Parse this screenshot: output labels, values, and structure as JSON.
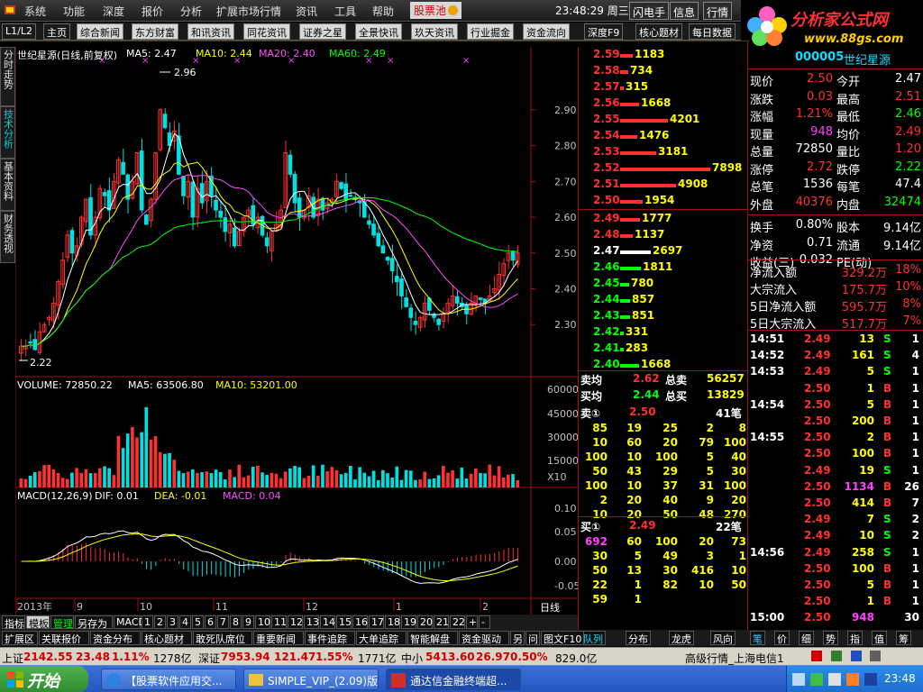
{
  "menu": {
    "items": [
      "系统",
      "功能",
      "深度",
      "报价",
      "分析",
      "扩展市场行情",
      "资讯",
      "工具",
      "帮助"
    ],
    "stock_pool": "股票池",
    "clock": "23:48:29 周三",
    "buttons": [
      "闪电手",
      "信息",
      "行情"
    ]
  },
  "logo": {
    "text": "分析家公式网",
    "url": "www.88gs.com"
  },
  "toolbar": {
    "level": "L1/L2",
    "home": "主页",
    "items": [
      "综合新闻",
      "东方财富",
      "和讯资讯",
      "同花资讯",
      "证券之星",
      "全景快讯",
      "玖天资讯",
      "行业掘金",
      "资金流向"
    ],
    "right": [
      "深度F9",
      "核心题材",
      "每日数据"
    ]
  },
  "left_tabs": [
    "分时走势",
    "技术分析",
    "基本资料",
    "财务透视"
  ],
  "chart": {
    "title": "世纪星源(日线,前复权)",
    "ma": [
      {
        "label": "MA5: 2.47",
        "color": "#ffffff"
      },
      {
        "label": "MA10: 2.44",
        "color": "#ffff00"
      },
      {
        "label": "MA20: 2.40",
        "color": "#ff4dff"
      },
      {
        "label": "MA60: 2.49",
        "color": "#00ff00"
      }
    ],
    "high_label": "2.96",
    "low_label": "2.22",
    "price_ticks": [
      "2.90",
      "2.80",
      "2.70",
      "2.60",
      "2.50",
      "2.40",
      "2.30"
    ],
    "volume_title": "VOLUME: 72850.22",
    "vol_ma5": "MA5: 63506.80",
    "vol_ma10": "MA10: 53201.00",
    "vol_ticks": [
      "60000",
      "45000",
      "30000",
      "15000",
      "X10"
    ],
    "macd_title": "MACD(12,26,9)",
    "macd_dif": "DIF: 0.01",
    "macd_dea": "DEA: -0.01",
    "macd_val": "MACD: 0.04",
    "macd_ticks": [
      "0.10",
      "0.05",
      "0.00",
      "-0.05"
    ],
    "date_axis": [
      "2013年",
      "9",
      "10",
      "11",
      "12",
      "1",
      "2"
    ],
    "period": "日线"
  },
  "sell_book": [
    {
      "price": "2.59",
      "vol": "1183",
      "fill": 0.14
    },
    {
      "price": "2.58",
      "vol": "734",
      "fill": 0.09
    },
    {
      "price": "2.57",
      "vol": "315",
      "fill": 0.04
    },
    {
      "price": "2.56",
      "vol": "1668",
      "fill": 0.21
    },
    {
      "price": "2.55",
      "vol": "4201",
      "fill": 0.53
    },
    {
      "price": "2.54",
      "vol": "1476",
      "fill": 0.19
    },
    {
      "price": "2.53",
      "vol": "3181",
      "fill": 0.4
    },
    {
      "price": "2.52",
      "vol": "7898",
      "fill": 1.0
    },
    {
      "price": "2.51",
      "vol": "4908",
      "fill": 0.62
    },
    {
      "price": "2.50",
      "vol": "1954",
      "fill": 0.25
    }
  ],
  "buy_book": [
    {
      "price": "2.49",
      "vol": "1777",
      "fill": 0.22,
      "pc": "#ff3030"
    },
    {
      "price": "2.48",
      "vol": "1137",
      "fill": 0.14,
      "pc": "#ff3030"
    },
    {
      "price": "2.47",
      "vol": "2697",
      "fill": 0.34,
      "pc": "#ffffff"
    },
    {
      "price": "2.46",
      "vol": "1811",
      "fill": 0.23,
      "pc": "#00ff00"
    },
    {
      "price": "2.45",
      "vol": "780",
      "fill": 0.1,
      "pc": "#00ff00"
    },
    {
      "price": "2.44",
      "vol": "857",
      "fill": 0.11,
      "pc": "#00ff00"
    },
    {
      "price": "2.43",
      "vol": "851",
      "fill": 0.11,
      "pc": "#00ff00"
    },
    {
      "price": "2.42",
      "vol": "331",
      "fill": 0.04,
      "pc": "#00ff00"
    },
    {
      "price": "2.41",
      "vol": "283",
      "fill": 0.04,
      "pc": "#00ff00"
    },
    {
      "price": "2.40",
      "vol": "1668",
      "fill": 0.21,
      "pc": "#00ff00"
    }
  ],
  "avg": {
    "sell_avg_label": "卖均",
    "sell_avg": "2.62",
    "sell_total_label": "总卖",
    "sell_total": "56257",
    "buy_avg_label": "买均",
    "buy_avg": "2.44",
    "buy_total_label": "总买",
    "buy_total": "13829"
  },
  "sell_queue": {
    "label": "卖①",
    "price": "2.50",
    "count": "41笔",
    "rows": [
      [
        "85",
        "19",
        "25",
        "2",
        "8"
      ],
      [
        "10",
        "60",
        "20",
        "79",
        "100"
      ],
      [
        "100",
        "10",
        "100",
        "5",
        "40"
      ],
      [
        "50",
        "43",
        "29",
        "5",
        "30"
      ],
      [
        "100",
        "10",
        "37",
        "31",
        "100"
      ],
      [
        "2",
        "20",
        "40",
        "9",
        "20"
      ],
      [
        "10",
        "20",
        "50",
        "48",
        "270"
      ]
    ]
  },
  "buy_queue": {
    "label": "买①",
    "price": "2.49",
    "count": "22笔",
    "rows": [
      [
        "692",
        "60",
        "100",
        "20",
        "73"
      ],
      [
        "30",
        "5",
        "49",
        "3",
        "1"
      ],
      [
        "50",
        "13",
        "30",
        "416",
        "10"
      ],
      [
        "22",
        "1",
        "82",
        "10",
        "50"
      ],
      [
        "59",
        "1",
        "",
        "",
        ""
      ]
    ]
  },
  "quote": {
    "code": "000005",
    "name": "世纪星源",
    "rows": [
      {
        "l1": "现价",
        "v1": "2.50",
        "c1": "#ff3030",
        "l2": "今开",
        "v2": "2.47",
        "c2": "#ffffff"
      },
      {
        "l1": "涨跌",
        "v1": "0.03",
        "c1": "#ff3030",
        "l2": "最高",
        "v2": "2.51",
        "c2": "#ff3030"
      },
      {
        "l1": "涨幅",
        "v1": "1.21%",
        "c1": "#ff3030",
        "l2": "最低",
        "v2": "2.46",
        "c2": "#00ff00"
      },
      {
        "l1": "现量",
        "v1": "948",
        "c1": "#ff40ff",
        "l2": "均价",
        "v2": "2.49",
        "c2": "#ff3030"
      },
      {
        "l1": "总量",
        "v1": "72850",
        "c1": "#ffffff",
        "l2": "量比",
        "v2": "1.20",
        "c2": "#ff3030"
      },
      {
        "l1": "涨停",
        "v1": "2.72",
        "c1": "#ff3030",
        "l2": "跌停",
        "v2": "2.22",
        "c2": "#00ff00"
      },
      {
        "l1": "总笔",
        "v1": "1536",
        "c1": "#ffffff",
        "l2": "每笔",
        "v2": "47.4",
        "c2": "#ffffff"
      },
      {
        "l1": "外盘",
        "v1": "40376",
        "c1": "#ff3030",
        "l2": "内盘",
        "v2": "32474",
        "c2": "#00ff00"
      },
      {
        "l1": "换手",
        "v1": "0.80%",
        "c1": "#ffffff",
        "l2": "股本",
        "v2": "9.14亿",
        "c2": "#ffffff"
      },
      {
        "l1": "净资",
        "v1": "0.71",
        "c1": "#ffffff",
        "l2": "流通",
        "v2": "9.14亿",
        "c2": "#ffffff"
      },
      {
        "l1": "收益(三)",
        "v1": "-0.032",
        "c1": "#ffffff",
        "l2": "PE(动)",
        "v2": "",
        "c2": "#ffffff"
      }
    ],
    "flows": [
      {
        "l": "净流入额",
        "v": "329.2万",
        "p": "18%"
      },
      {
        "l": "大宗流入",
        "v": "175.7万",
        "p": "10%"
      },
      {
        "l": "5日净流入额",
        "v": "595.7万",
        "p": "8%"
      },
      {
        "l": "5日大宗流入",
        "v": "517.7万",
        "p": "7%"
      }
    ]
  },
  "trades": [
    {
      "t": "14:51",
      "p": "2.49",
      "v": "13",
      "s": "S",
      "n": "1"
    },
    {
      "t": "14:52",
      "p": "2.49",
      "v": "161",
      "s": "S",
      "n": "4"
    },
    {
      "t": "14:53",
      "p": "2.49",
      "v": "5",
      "s": "S",
      "n": "1"
    },
    {
      "t": "",
      "p": "2.50",
      "v": "1",
      "s": "B",
      "n": "1"
    },
    {
      "t": "14:54",
      "p": "2.50",
      "v": "5",
      "s": "B",
      "n": "1"
    },
    {
      "t": "",
      "p": "2.50",
      "v": "200",
      "s": "B",
      "n": "1"
    },
    {
      "t": "14:55",
      "p": "2.50",
      "v": "2",
      "s": "B",
      "n": "1"
    },
    {
      "t": "",
      "p": "2.50",
      "v": "100",
      "s": "B",
      "n": "1"
    },
    {
      "t": "",
      "p": "2.49",
      "v": "19",
      "s": "S",
      "n": "1"
    },
    {
      "t": "",
      "p": "2.50",
      "v": "1134",
      "s": "B",
      "n": "26"
    },
    {
      "t": "",
      "p": "2.50",
      "v": "414",
      "s": "B",
      "n": "7"
    },
    {
      "t": "",
      "p": "2.49",
      "v": "7",
      "s": "S",
      "n": "2"
    },
    {
      "t": "",
      "p": "2.49",
      "v": "10",
      "s": "S",
      "n": "2"
    },
    {
      "t": "14:56",
      "p": "2.49",
      "v": "258",
      "s": "S",
      "n": "1"
    },
    {
      "t": "",
      "p": "2.50",
      "v": "100",
      "s": "B",
      "n": "1"
    },
    {
      "t": "",
      "p": "2.50",
      "v": "5",
      "s": "B",
      "n": "1"
    },
    {
      "t": "",
      "p": "2.50",
      "v": "1",
      "s": "B",
      "n": "1"
    },
    {
      "t": "15:00",
      "p": "2.50",
      "v": "948",
      "s": "",
      "n": "30"
    }
  ],
  "indicator_tabs": [
    "指标",
    "模板",
    "管理",
    "另存为",
    "MACD",
    "1",
    "2",
    "3",
    "4",
    "5",
    "6",
    "7",
    "8",
    "9",
    "10",
    "11",
    "12",
    "13",
    "14",
    "15",
    "16",
    "17",
    "18",
    "19",
    "20",
    "21",
    "22",
    "+",
    "-"
  ],
  "main_tabs": [
    "扩展区",
    "关联报价",
    "资金分布",
    "核心题材",
    "敢死队席位",
    "重要新闻",
    "事件追踪",
    "大单追踪",
    "智能解盘",
    "资金驱动",
    "另",
    "问",
    "图文F10"
  ],
  "right_tabs": [
    "队列",
    "分布",
    "龙虎",
    "风向"
  ],
  "right_small_tabs": [
    "笔",
    "价",
    "细",
    "势",
    "指",
    "值",
    "筹"
  ],
  "status": {
    "sh_label": "上证",
    "sh_val": "2142.55",
    "sh_chg": "23.48",
    "sh_pct": "1.11%",
    "sh_amt": "1278亿",
    "sz_label": "深证",
    "sz_val": "7953.94",
    "sz_chg": "121.47",
    "sz_pct": "1.55%",
    "sz_amt": "1771亿",
    "zx_label": "中小",
    "zx_val": "5413.60",
    "zx_chg": "26.97",
    "zx_pct": "0.50%",
    "zx_amt": "829.0亿",
    "server": "高级行情_上海电信1"
  },
  "taskbar": {
    "start": "开始",
    "tasks": [
      "【股票软件应用交...",
      "SIMPLE_VIP_(2.09)版",
      "通达信金融终端超..."
    ],
    "time": "23:48"
  },
  "colors": {
    "up": "#ff3030",
    "down": "#00ff00",
    "axis": "#a01010"
  }
}
